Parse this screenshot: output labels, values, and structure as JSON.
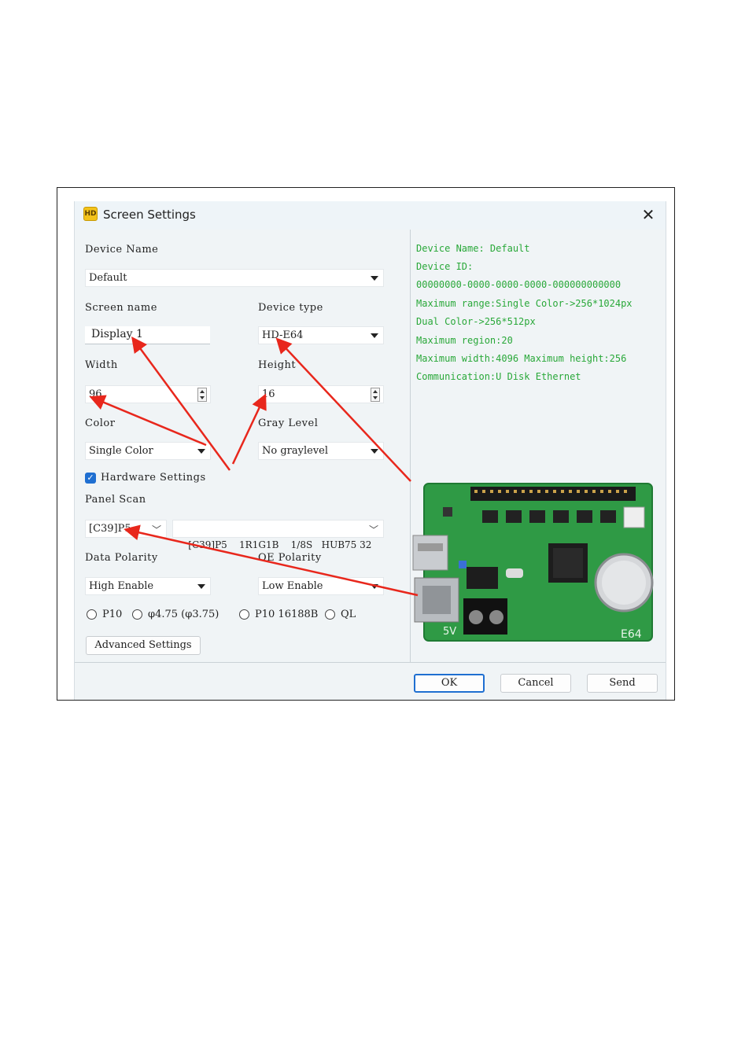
{
  "dialog": {
    "title": "Screen Settings",
    "close_glyph": "✕",
    "app_icon_text": "HD"
  },
  "form": {
    "device_name_label": "Device Name",
    "device_name_value": "Default",
    "screen_name_label": "Screen name",
    "screen_name_value": "Display 1",
    "device_type_label": "Device type",
    "device_type_value": "HD-E64",
    "width_label": "Width",
    "width_value": "96",
    "height_label": "Height",
    "height_value": "16",
    "color_label": "Color",
    "color_value": "Single Color",
    "gray_level_label": "Gray Level",
    "gray_level_value": "No graylevel",
    "hardware_settings_label": "Hardware Settings",
    "hardware_settings_checked": true,
    "panel_scan_label": "Panel Scan",
    "panel_scan_value": "[C39]P5",
    "panel_scan_detail": "[C39]P5    1R1G1B    1/8S   HUB75 32",
    "data_polarity_label": "Data Polarity",
    "data_polarity_value": "High Enable",
    "oe_polarity_label": "OE Polarity",
    "oe_polarity_value": "Low Enable",
    "radio_options": [
      "P10",
      "φ4.75 (φ3.75)",
      "P10 16188B",
      "QL"
    ],
    "advanced_button": "Advanced Settings"
  },
  "info_panel": {
    "lines": [
      "Device Name: Default",
      "Device ID:",
      "00000000-0000-0000-0000-000000000000",
      "Maximum range:Single Color->256*1024px",
      "Dual Color->256*512px",
      "Maximum region:20",
      "Maximum width:4096 Maximum height:256",
      "Communication:U Disk  Ethernet"
    ],
    "board_label": "E64",
    "board_voltage": "5V"
  },
  "footer": {
    "ok": "OK",
    "cancel": "Cancel",
    "send": "Send"
  },
  "colors": {
    "info_text": "#29a839",
    "board_green": "#2f9a45",
    "annotation_arrow": "#e8271c",
    "accent": "#1f6fd1"
  }
}
